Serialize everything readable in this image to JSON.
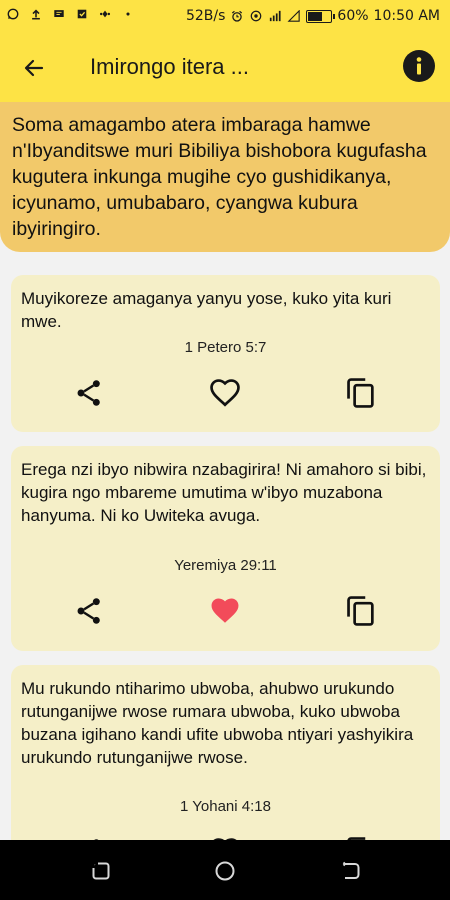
{
  "status": {
    "speed": "52B/s",
    "battery": "60%",
    "time": "10:50 AM",
    "battery_level": 0.6
  },
  "appbar": {
    "title": "Imirongo itera ...",
    "back_icon": "arrow-left-icon",
    "info_icon": "info-icon"
  },
  "intro": "Soma amagambo atera imbaraga hamwe n'Ibyanditswe muri Bibiliya bishobora kugufasha kugutera inkunga mugihe cyo gushidikanya, icyunamo, umubabaro, cyangwa kubura ibyiringiro.",
  "verses": [
    {
      "text": "Muyikoreze amaganya yanyu yose, kuko yita kuri mwe.",
      "ref": "1 Petero 5:7",
      "liked": false
    },
    {
      "text": "Erega nzi ibyo nibwira nzabagirira! Ni amahoro si bibi, kugira ngo mbareme umutima w'ibyo muzabona hanyuma. Ni ko Uwiteka avuga.",
      "ref": "Yeremiya 29:11",
      "liked": true
    },
    {
      "text": "Mu rukundo ntiharimo ubwoba, ahubwo urukundo rutunganijwe rwose rumara ubwoba, kuko ubwoba buzana igihano kandi ufite ubwoba ntiyari yashyikira urukundo rutunganijwe rwose.",
      "ref": "1 Yohani 4:18",
      "liked": false
    }
  ],
  "colors": {
    "accent": "#fde345",
    "intro_bg": "#f2c96a",
    "card_bg": "#f5efc8",
    "liked": "#f24b5a"
  }
}
